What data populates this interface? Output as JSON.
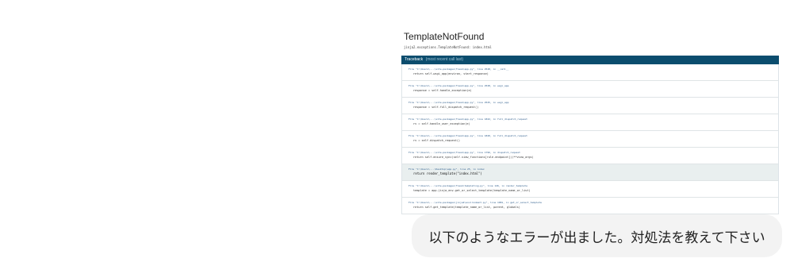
{
  "screenshot": {
    "title": "TemplateNotFound",
    "subtitle": "jinja2.exceptions.TemplateNotFound: index.html",
    "traceback_header": "Traceback",
    "traceback_switch": "(most recent call last)",
    "frames": [
      {
        "file": "File \"C:\\Users\\...\\site-packages\\flask\\app.py\", line 2548, in __call__",
        "code": "return self.wsgi_app(environ, start_response)"
      },
      {
        "file": "File \"C:\\Users\\...\\site-packages\\flask\\app.py\", line 2528, in wsgi_app",
        "code": "response = self.handle_exception(e)"
      },
      {
        "file": "File \"C:\\Users\\...\\site-packages\\flask\\app.py\", line 2525, in wsgi_app",
        "code": "response = self.full_dispatch_request()"
      },
      {
        "file": "File \"C:\\Users\\...\\site-packages\\flask\\app.py\", line 1822, in full_dispatch_request",
        "code": "rv = self.handle_user_exception(e)"
      },
      {
        "file": "File \"C:\\Users\\...\\site-packages\\flask\\app.py\", line 1820, in full_dispatch_request",
        "code": "rv = self.dispatch_request()"
      },
      {
        "file": "File \"C:\\Users\\...\\site-packages\\flask\\app.py\", line 1796, in dispatch_request",
        "code": "return self.ensure_sync(self.view_functions[rule.endpoint])(**view_args)"
      },
      {
        "file": "File \"C:\\Users\\...\\Desktop\\app.py\", line 25, in index",
        "code": "return render_template(\"index.html\")",
        "current": true
      },
      {
        "file": "File \"C:\\Users\\...\\site-packages\\flask\\templating.py\", line 146, in render_template",
        "code": "template = app.jinja_env.get_or_select_template(template_name_or_list)"
      },
      {
        "file": "File \"C:\\Users\\...\\site-packages\\jinja2\\environment.py\", line 1081, in get_or_select_template",
        "code": "return self.get_template(template_name_or_list, parent, globals)"
      }
    ]
  },
  "chat": {
    "message": "以下のようなエラーが出ました。対処法を教えて下さい"
  }
}
